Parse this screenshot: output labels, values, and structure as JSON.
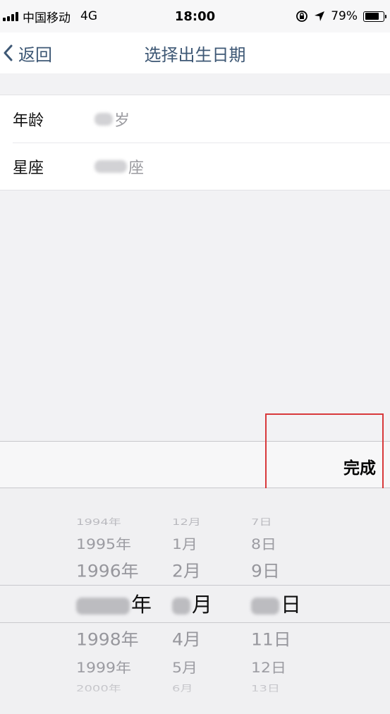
{
  "status_bar": {
    "carrier": "中国移动",
    "network": "4G",
    "time": "18:00",
    "battery_pct_text": "79%",
    "battery_level": 0.79
  },
  "nav": {
    "back_label": "返回",
    "title": "选择出生日期"
  },
  "info": {
    "age_label": "年龄",
    "age_value": "岁",
    "zodiac_label": "星座",
    "zodiac_value": "座"
  },
  "toolbar": {
    "done_label": "完成"
  },
  "picker": {
    "years": [
      "1994年",
      "1995年",
      "1996年",
      "年",
      "1998年",
      "1999年",
      "2000年"
    ],
    "months": [
      "12月",
      "1月",
      "2月",
      "月",
      "4月",
      "5月",
      "6月"
    ],
    "days": [
      "7日",
      "8日",
      "9日",
      "日",
      "11日",
      "12日",
      "13日"
    ],
    "selected_index": 3
  },
  "colors": {
    "accent": "#3e5875",
    "highlight": "#d8393b",
    "background": "#f2f2f4"
  }
}
